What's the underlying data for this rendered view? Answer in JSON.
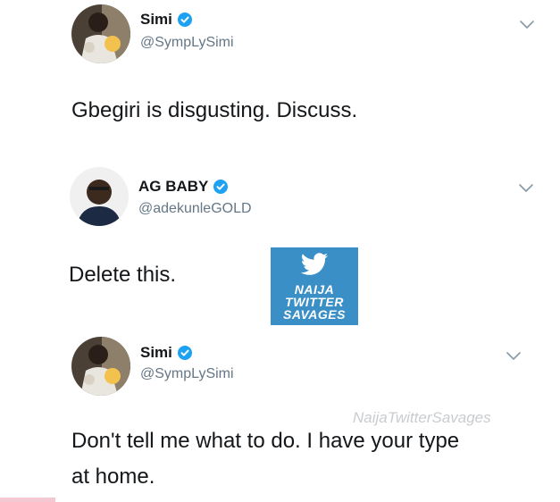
{
  "tweets": [
    {
      "name": "Simi",
      "handle": "@SympLySimi",
      "text": "Gbegiri is disgusting. Discuss.",
      "avatar_icon": "profile-photo",
      "verified": true
    },
    {
      "name": "AG BABY",
      "handle": "@adekunleGOLD",
      "text": "Delete this.",
      "avatar_icon": "profile-photo",
      "verified": true
    },
    {
      "name": "Simi",
      "handle": "@SympLySimi",
      "text_line1": "Don't tell me what to do. I have your type",
      "text_line2": "at home.",
      "avatar_icon": "profile-photo",
      "verified": true
    }
  ],
  "watermark": {
    "line1": "NAIJA",
    "line2": "TWITTER",
    "line3": "SAVAGES",
    "text": "NaijaTwitterSavages"
  },
  "colors": {
    "verified": "#1da1f2",
    "handle": "#657786",
    "watermark_bg": "#3b8fc7"
  }
}
